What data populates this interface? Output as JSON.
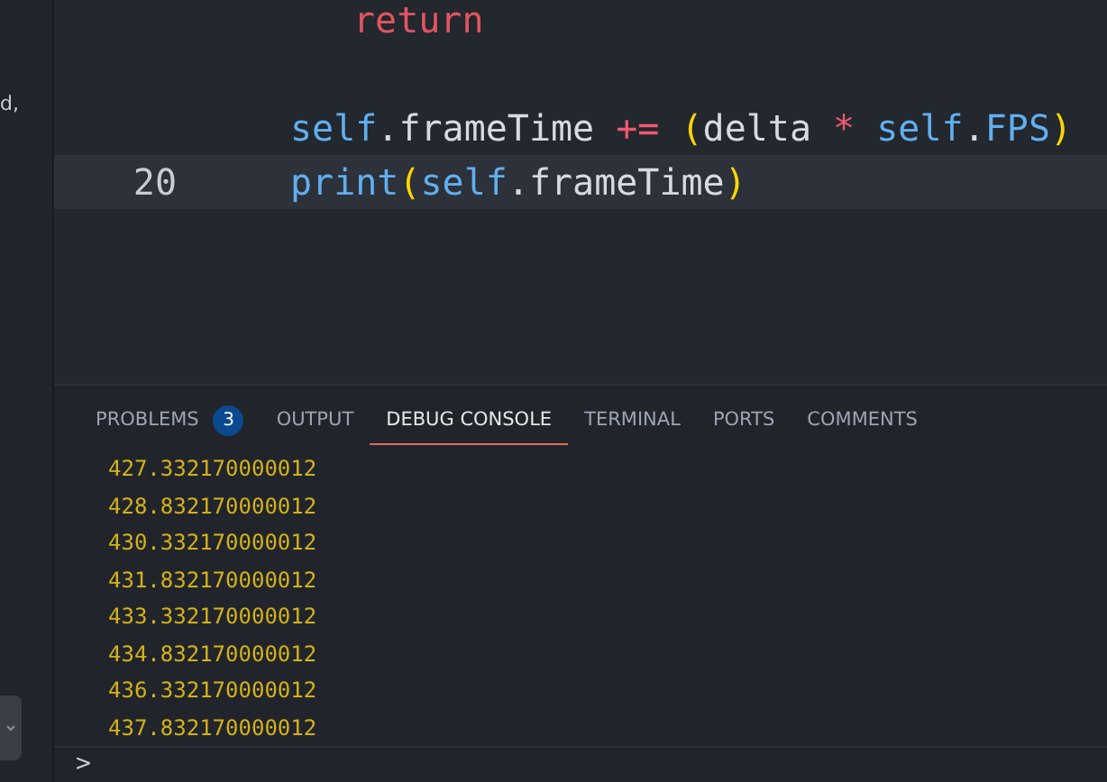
{
  "sidebar": {
    "fragments": [
      "d,"
    ]
  },
  "editor": {
    "lines": [
      {
        "current": false,
        "kind": "nested",
        "tokens": [
          {
            "kind": "keyword",
            "text": "return"
          }
        ]
      },
      {
        "current": false,
        "kind": "body"
      },
      {
        "current": false,
        "kind": "body",
        "tokens": [
          {
            "kind": "var",
            "text": "self"
          },
          {
            "kind": "plain",
            "text": ".frameTime "
          },
          {
            "kind": "op",
            "text": "+= "
          },
          {
            "kind": "bracket",
            "text": "("
          },
          {
            "kind": "plain",
            "text": "delta "
          },
          {
            "kind": "op",
            "text": "* "
          },
          {
            "kind": "var",
            "text": "self"
          },
          {
            "kind": "plain",
            "text": "."
          },
          {
            "kind": "var",
            "text": "FPS"
          },
          {
            "kind": "bracket",
            "text": ")"
          }
        ]
      },
      {
        "number": "20",
        "current": true,
        "kind": "body",
        "tokens": [
          {
            "kind": "var",
            "text": "print"
          },
          {
            "kind": "bracket",
            "text": "("
          },
          {
            "kind": "var",
            "text": "self"
          },
          {
            "kind": "plain",
            "text": ".frameTime"
          },
          {
            "kind": "bracket",
            "text": ")"
          }
        ]
      }
    ]
  },
  "panel": {
    "tabs": [
      {
        "label": "PROBLEMS",
        "badge": "3",
        "selected": false
      },
      {
        "label": "OUTPUT",
        "selected": false
      },
      {
        "label": "DEBUG CONSOLE",
        "selected": true
      },
      {
        "label": "TERMINAL",
        "selected": false
      },
      {
        "label": "PORTS",
        "selected": false
      },
      {
        "label": "COMMENTS",
        "selected": false
      }
    ],
    "console_lines": [
      "427.332170000012",
      "428.832170000012",
      "430.332170000012",
      "431.832170000012",
      "433.332170000012",
      "434.832170000012",
      "436.332170000012",
      "437.832170000012"
    ],
    "prompt": ">"
  }
}
